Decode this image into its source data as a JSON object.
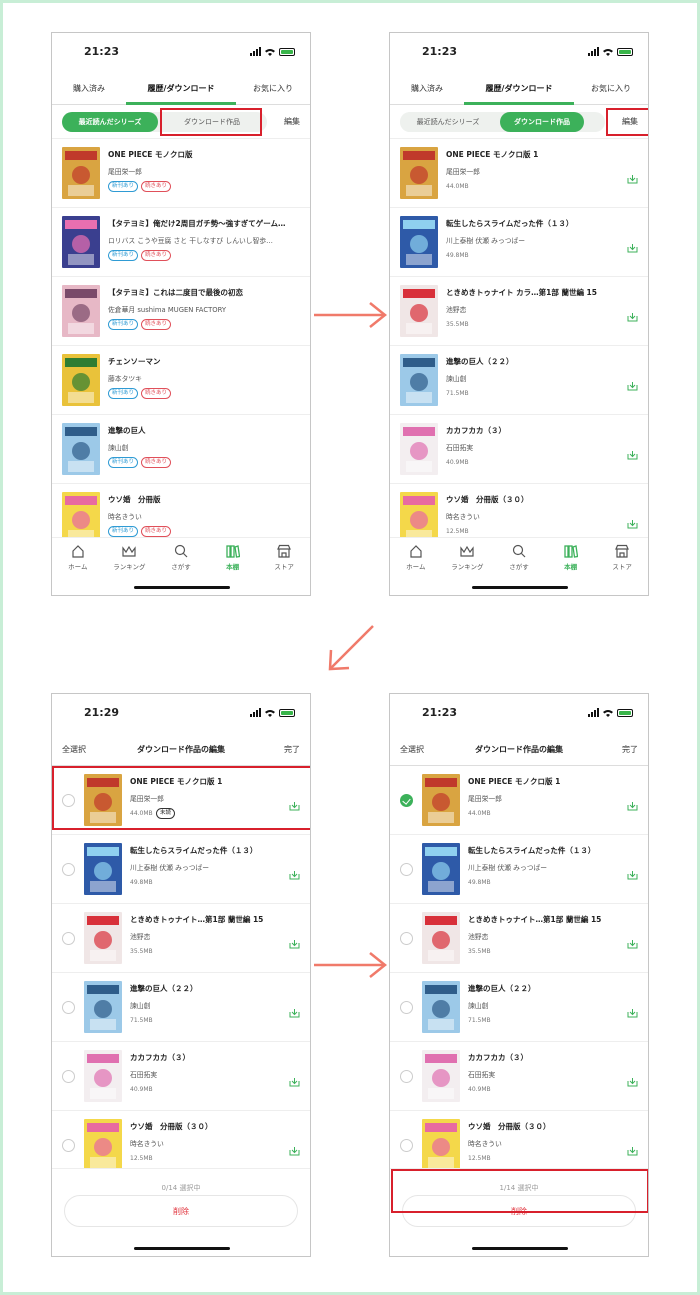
{
  "colors": {
    "accent": "#3cb15a",
    "highlight": "#d8202c",
    "arrow": "#f07a6a",
    "tag_new": "#2f9bd4",
    "tag_more": "#e0505a"
  },
  "screens": [
    {
      "time": "21:23"
    },
    {
      "time": "21:23"
    },
    {
      "time": "21:29"
    },
    {
      "time": "21:23"
    }
  ],
  "tabs": {
    "purchased": "購入済み",
    "history": "履歴/ダウンロード",
    "favorites": "お気に入り"
  },
  "filters": {
    "recent": "最近読んだシリーズ",
    "downloaded": "ダウンロード作品",
    "edit": "編集"
  },
  "tags": {
    "new": "新刊あり",
    "more": "続きあり"
  },
  "recent_list": [
    {
      "title": "ONE PIECE モノクロ版",
      "author": "尾田栄一郎"
    },
    {
      "title": "【タテヨミ】俺だけ2周目ガチ勢〜強すぎてゲーム…",
      "author": "ロリバス こうや豆腐 さと 干しなすび しんいし智歩…"
    },
    {
      "title": "【タテヨミ】これは二度目で最後の初恋",
      "author": "佐倉華月 sushima MUGEN FACTORY"
    },
    {
      "title": "チェンソーマン",
      "author": "藤本タツキ"
    },
    {
      "title": "進撃の巨人",
      "author": "諫山創"
    },
    {
      "title": "ウソ婚　分冊版",
      "author": "時名きうい"
    }
  ],
  "download_list": [
    {
      "title": "ONE PIECE モノクロ版 1",
      "author": "尾田栄一郎",
      "size": "44.0MB"
    },
    {
      "title": "転生したらスライムだった件（１３）",
      "author": "川上泰樹 伏瀬 みっつばー",
      "size": "49.8MB"
    },
    {
      "title": "ときめきトゥナイト カラ…第1部 蘭世編 15",
      "author": "池野恋",
      "size": "35.5MB"
    },
    {
      "title": "進撃の巨人（２２）",
      "author": "諫山創",
      "size": "71.5MB"
    },
    {
      "title": "カカフカカ（３）",
      "author": "石田拓実",
      "size": "40.9MB"
    },
    {
      "title": "ウソ婚　分冊版（３０）",
      "author": "時名きうい",
      "size": "12.5MB"
    }
  ],
  "edit_list": [
    {
      "title": "ONE PIECE モノクロ版 1",
      "author": "尾田栄一郎",
      "size": "44.0MB"
    },
    {
      "title": "転生したらスライムだった件（１３）",
      "author": "川上泰樹 伏瀬 みっつばー",
      "size": "49.8MB"
    },
    {
      "title": "ときめきトゥナイト…第1部 蘭世編 15",
      "author": "池野恋",
      "size": "35.5MB"
    },
    {
      "title": "進撃の巨人（２２）",
      "author": "諫山創",
      "size": "71.5MB"
    },
    {
      "title": "カカフカカ（３）",
      "author": "石田拓実",
      "size": "40.9MB"
    },
    {
      "title": "ウソ婚　分冊版（３０）",
      "author": "時名きうい",
      "size": "12.5MB"
    }
  ],
  "unread_badge": "未読",
  "edit_header": {
    "select_all": "全選択",
    "title": "ダウンロード作品の編集",
    "done": "完了"
  },
  "footer_a": {
    "count": "0/14 選択中",
    "delete": "削除"
  },
  "footer_b": {
    "count": "1/14 選択中",
    "delete": "削除"
  },
  "nav": {
    "home": "ホーム",
    "ranking": "ランキング",
    "search": "さがす",
    "shelf": "本棚",
    "store": "ストア"
  },
  "covers": [
    {
      "bg": "#d9a441",
      "fg": "#c0392b"
    },
    {
      "bg": "#3a3f8f",
      "fg": "#e96fb0"
    },
    {
      "bg": "#e7b8c6",
      "fg": "#7a4a6a"
    },
    {
      "bg": "#e9c23a",
      "fg": "#2e7d32"
    },
    {
      "bg": "#9cc9e8",
      "fg": "#2f5d8a"
    },
    {
      "bg": "#f4d84a",
      "fg": "#e86aa0"
    }
  ],
  "dcovers": [
    {
      "bg": "#d9a441",
      "fg": "#c0392b"
    },
    {
      "bg": "#2e5aa8",
      "fg": "#8fd0ef"
    },
    {
      "bg": "#f0e6e6",
      "fg": "#d8303a"
    },
    {
      "bg": "#9cc9e8",
      "fg": "#2f5d8a"
    },
    {
      "bg": "#f3eef0",
      "fg": "#e070b0"
    },
    {
      "bg": "#f4d84a",
      "fg": "#e86aa0"
    }
  ]
}
